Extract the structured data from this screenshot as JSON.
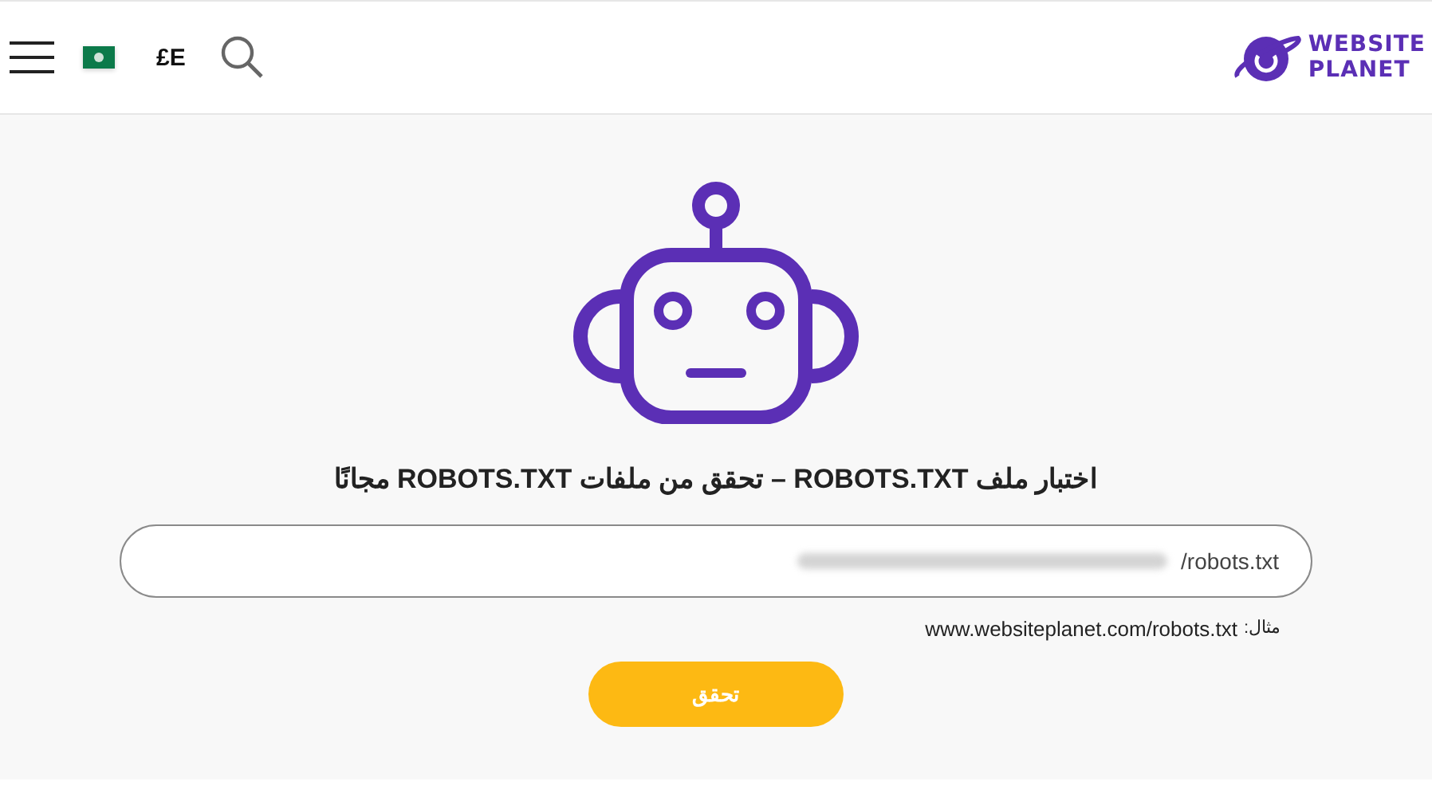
{
  "header": {
    "logo": {
      "line_1": "WEBSITE",
      "line_2": "PLANET"
    },
    "currency": "£E"
  },
  "main": {
    "title": "اختبار ملف ROBOTS.TXT – تحقق من ملفات ROBOTS.TXT مجانًا",
    "url_field": {
      "placeholder": "/robots.txt"
    },
    "example": {
      "label": "مثال:",
      "value": "www.websiteplanet.com/robots.txt"
    },
    "submit": "تحقق"
  }
}
